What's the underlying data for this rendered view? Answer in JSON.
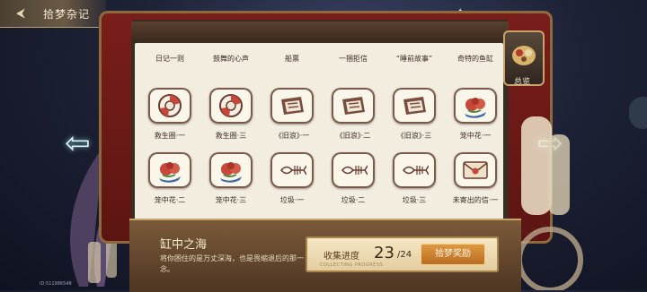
{
  "header": {
    "title": "拾梦杂记",
    "back_icon": "back-arrow-icon"
  },
  "sparkles": [
    "sparkle-icon",
    "sparkle-icon"
  ],
  "overview": {
    "label": "总览"
  },
  "items": [
    {
      "label": "日记一则",
      "icon": "note-icon"
    },
    {
      "label": "鼓舞的心声",
      "icon": "note-icon"
    },
    {
      "label": "船票",
      "icon": "ticket-icon"
    },
    {
      "label": "一捆拒信",
      "icon": "letters-icon"
    },
    {
      "label": "“睡前故事”",
      "icon": "book-icon"
    },
    {
      "label": "奇特的鱼缸",
      "icon": "fishbowl-icon"
    },
    {
      "label": "救生圈·一",
      "icon": "lifebuoy-icon"
    },
    {
      "label": "救生圈·三",
      "icon": "lifebuoy-icon"
    },
    {
      "label": "《旧浪》·一",
      "icon": "newspaper-icon"
    },
    {
      "label": "《旧浪》·二",
      "icon": "newspaper-icon"
    },
    {
      "label": "《旧浪》·三",
      "icon": "newspaper-icon"
    },
    {
      "label": "笼中花·一",
      "icon": "flower-icon"
    },
    {
      "label": "笼中花·二",
      "icon": "flower-icon"
    },
    {
      "label": "笼中花·三",
      "icon": "flower-icon"
    },
    {
      "label": "垃圾·一",
      "icon": "fishbone-icon"
    },
    {
      "label": "垃圾·二",
      "icon": "fishbone-icon"
    },
    {
      "label": "垃圾·三",
      "icon": "fishbone-icon"
    },
    {
      "label": "未寄出的信·一",
      "icon": "envelope-icon"
    }
  ],
  "detail": {
    "title": "缸中之海",
    "description": "将你困住的是万丈深海，也是畏缩退后的那一念。"
  },
  "progress": {
    "label": "收集进度",
    "current": "23",
    "total": "/24",
    "subtitle": "COLLECTING PROGRESS",
    "fraction": 0.958
  },
  "reward_button": {
    "label": "拾梦奖励"
  },
  "uid": "ID:511986548",
  "colors": {
    "book_red": "#7a1e1a",
    "paper": "#f3ede0",
    "gold": "#c9a46a",
    "button_orange": "#d08535"
  }
}
